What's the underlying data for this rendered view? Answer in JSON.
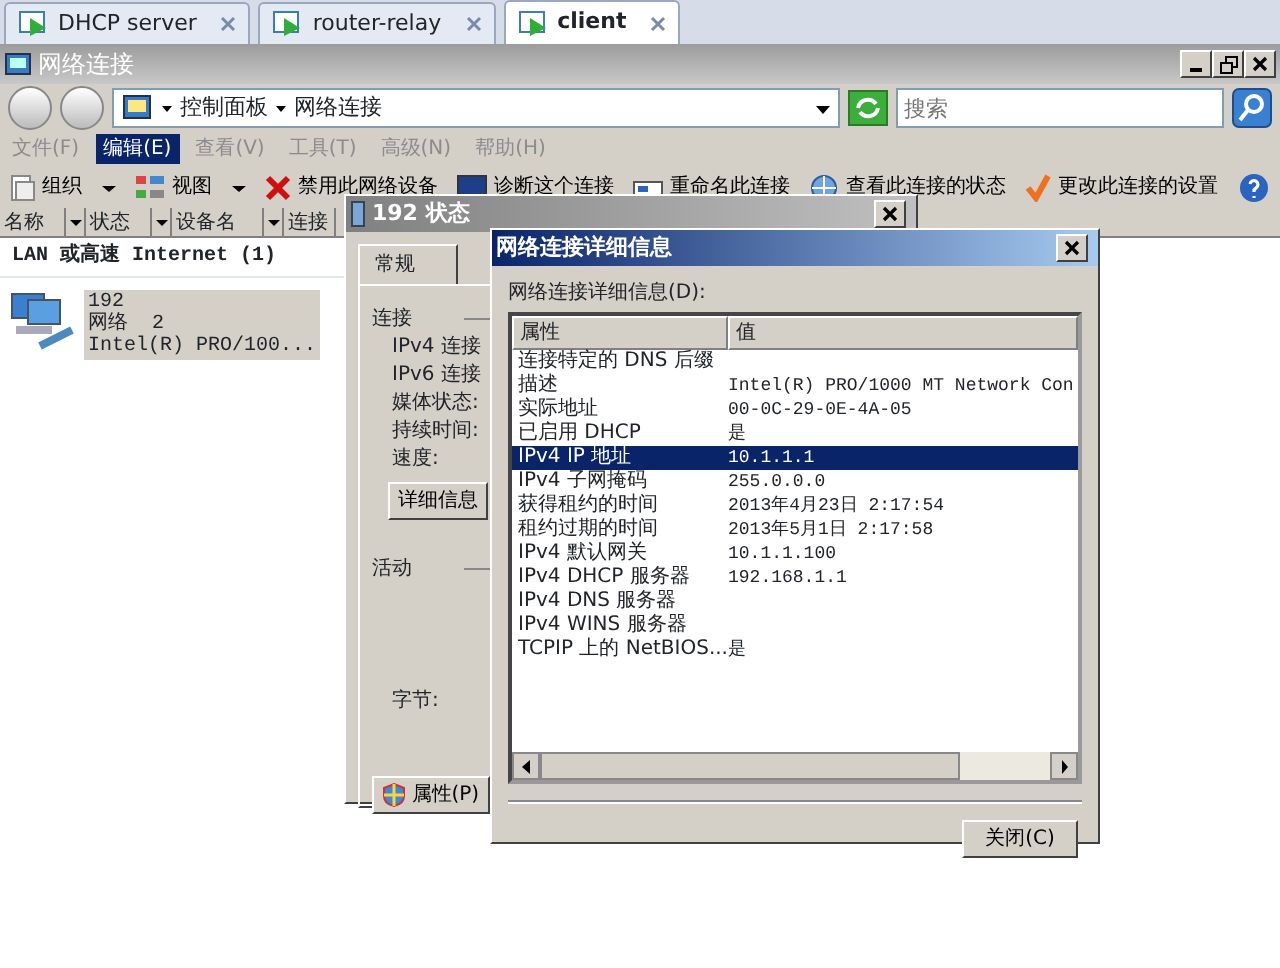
{
  "tabs": [
    {
      "label": "DHCP server",
      "selected": false
    },
    {
      "label": "router-relay",
      "selected": false
    },
    {
      "label": "client",
      "selected": true
    }
  ],
  "window": {
    "title": "网络连接"
  },
  "address_bar": {
    "breadcrumb": [
      "控制面板",
      "网络连接"
    ],
    "search_placeholder": "搜索"
  },
  "menu": [
    {
      "label": "文件(F)",
      "selected": false
    },
    {
      "label": "编辑(E)",
      "selected": true
    },
    {
      "label": "查看(V)",
      "selected": false
    },
    {
      "label": "工具(T)",
      "selected": false
    },
    {
      "label": "高级(N)",
      "selected": false
    },
    {
      "label": "帮助(H)",
      "selected": false
    }
  ],
  "toolbar": [
    {
      "label": "组织",
      "kind": "dropdown"
    },
    {
      "label": "视图",
      "kind": "dropdown"
    },
    {
      "label": "禁用此网络设备",
      "kind": "action"
    },
    {
      "label": "诊断这个连接",
      "kind": "action"
    },
    {
      "label": "重命名此连接",
      "kind": "action"
    },
    {
      "label": "查看此连接的状态",
      "kind": "action"
    },
    {
      "label": "更改此连接的设置",
      "kind": "action"
    }
  ],
  "columns": [
    "名称",
    "状态",
    "设备名",
    "连接"
  ],
  "group": {
    "title": "LAN 或高速 Internet (1)",
    "items": [
      {
        "name": "192",
        "network": "网络  2",
        "device": "Intel(R) PRO/100...",
        "selected": true
      }
    ]
  },
  "status_dialog": {
    "title": "192 状态",
    "tabs": [
      {
        "label": "常规",
        "selected": true
      }
    ],
    "sections": [
      {
        "heading": "连接",
        "fields": [
          "IPv4 连接",
          "IPv6 连接",
          "媒体状态:",
          "持续时间:",
          "速度:"
        ],
        "button": "详细信息"
      },
      {
        "heading": "活动",
        "fields": [
          "字节:"
        ]
      }
    ],
    "properties_button": "属性(P)"
  },
  "details_dialog": {
    "title": "网络连接详细信息",
    "label": "网络连接详细信息(D):",
    "columns": [
      "属性",
      "值"
    ],
    "rows": [
      {
        "property": "连接特定的 DNS 后缀",
        "value": "",
        "selected": false
      },
      {
        "property": "描述",
        "value": "Intel(R) PRO/1000 MT Network Con",
        "selected": false
      },
      {
        "property": "实际地址",
        "value": "00-0C-29-0E-4A-05",
        "selected": false
      },
      {
        "property": "已启用 DHCP",
        "value": "是",
        "selected": false
      },
      {
        "property": "IPv4 IP 地址",
        "value": "10.1.1.1",
        "selected": true
      },
      {
        "property": "IPv4 子网掩码",
        "value": "255.0.0.0",
        "selected": false
      },
      {
        "property": "获得租约的时间",
        "value": "2013年4月23日 2:17:54",
        "selected": false
      },
      {
        "property": "租约过期的时间",
        "value": "2013年5月1日 2:17:58",
        "selected": false
      },
      {
        "property": "IPv4 默认网关",
        "value": "10.1.1.100",
        "selected": false
      },
      {
        "property": "IPv4 DHCP 服务器",
        "value": "192.168.1.1",
        "selected": false
      },
      {
        "property": "IPv4 DNS 服务器",
        "value": "",
        "selected": false
      },
      {
        "property": "IPv4 WINS 服务器",
        "value": "",
        "selected": false
      },
      {
        "property": "TCPIP 上的 NetBIOS...",
        "value": "是",
        "selected": false
      }
    ],
    "close_button": "关闭(C)"
  }
}
